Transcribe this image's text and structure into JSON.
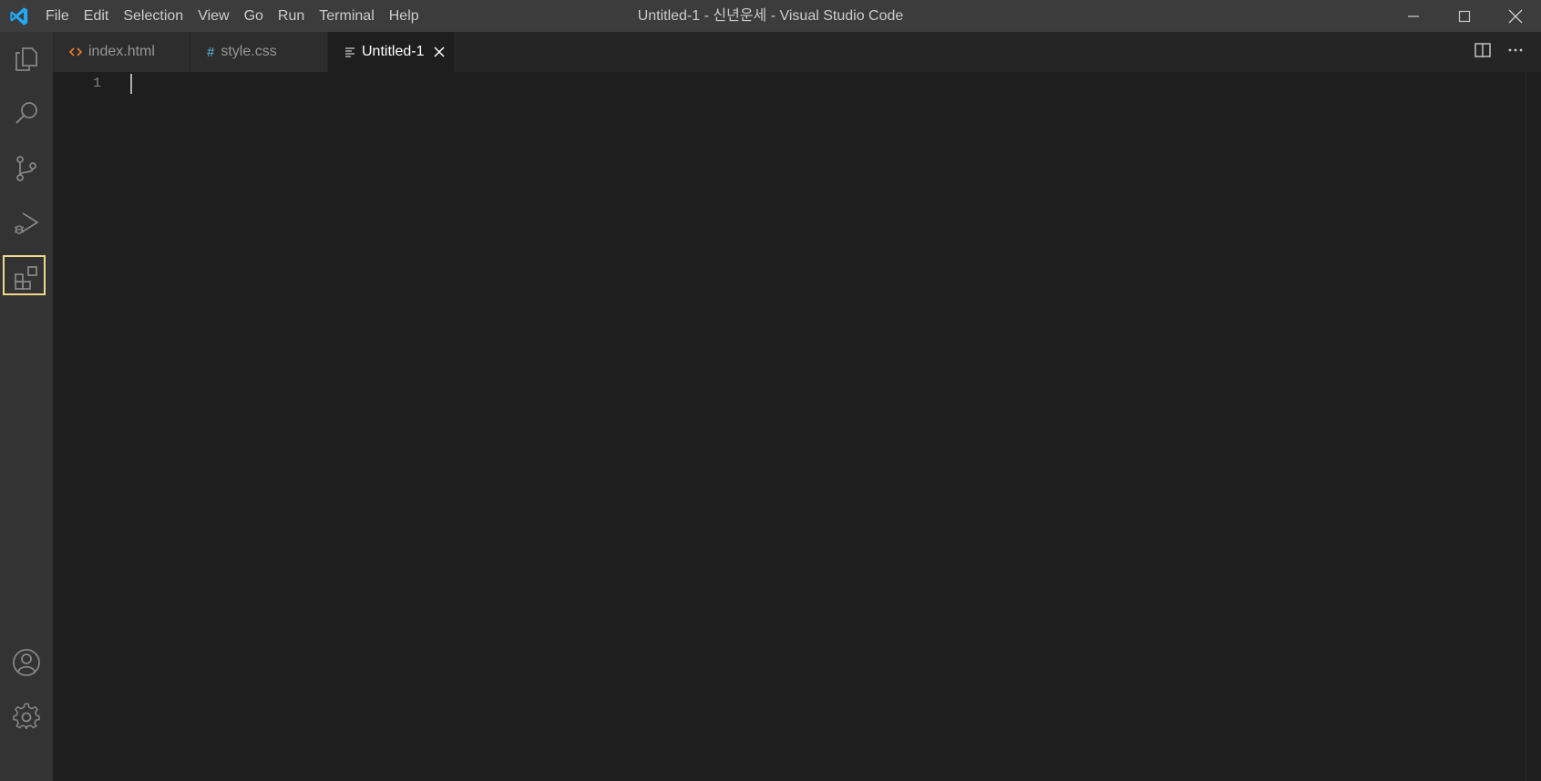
{
  "window": {
    "title": "Untitled-1 - 신년운세 - Visual Studio Code",
    "app_icon": "vscode-logo-icon",
    "accent": "#007acc"
  },
  "menu": [
    "File",
    "Edit",
    "Selection",
    "View",
    "Go",
    "Run",
    "Terminal",
    "Help"
  ],
  "activity_bar": {
    "items": [
      "explorer-icon",
      "search-icon",
      "source-control-icon",
      "run-debug-icon",
      "extensions-icon"
    ],
    "bottom_items": [
      "account-icon",
      "manage-gear-icon"
    ],
    "highlighted": "extensions-icon",
    "highlight_color": "#f1d98a"
  },
  "tabs": [
    {
      "label": "index.html",
      "icon": "html-file-icon",
      "icon_color": "#e37933",
      "active": false
    },
    {
      "label": "style.css",
      "icon": "css-file-icon",
      "icon_color": "#519aba",
      "active": false
    },
    {
      "label": "Untitled-1",
      "icon": "text-file-icon",
      "icon_color": "#cccccc",
      "active": true
    }
  ],
  "tab_actions": [
    "split-editor-icon",
    "more-actions-icon"
  ],
  "editor": {
    "line_numbers": [
      "1"
    ],
    "content": ""
  }
}
